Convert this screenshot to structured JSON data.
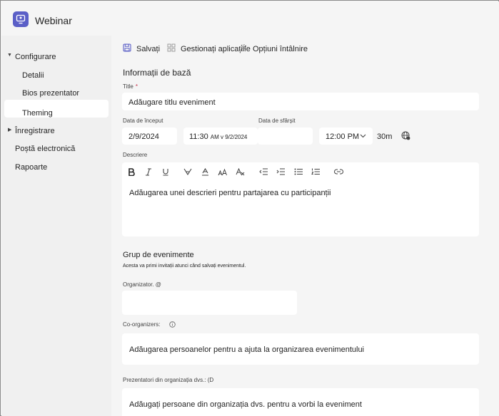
{
  "app": {
    "title": "Webinar"
  },
  "sidebar": {
    "sections": [
      {
        "label": "Configurare",
        "expanded": true
      },
      {
        "label": "Înregistrare",
        "expanded": false
      }
    ],
    "items": [
      {
        "label": "Detalii",
        "selected": true
      },
      {
        "label": "Bios prezentator"
      },
      {
        "label": "Theming"
      },
      {
        "label": "Poștă electronică"
      },
      {
        "label": "Rapoarte"
      }
    ]
  },
  "toolbar": {
    "save_label": "Salvați",
    "manage_apps_label": "Gestionați aplicațiile",
    "meeting_options_label": "Opțiuni întâlnire"
  },
  "form": {
    "basic_info_title": "Informații de bază",
    "title_label": "Title",
    "title_required_mark": "*",
    "title_placeholder": "Adăugare titlu eveniment",
    "start_date_label": "Data de început",
    "start_date": "2/9/2024",
    "start_time": "11:30",
    "start_time_suffix": "AM v 9/2/2024",
    "end_date_label": "Data de sfârșit",
    "end_date": "",
    "end_time": "12:00 PM",
    "duration": "30m",
    "description_label": "Descriere",
    "description_placeholder": "Adăugarea unei descrieri pentru partajarea cu participanții",
    "group_title": "Grup de evenimente",
    "group_help": "Acesta va primi invitații atunci când salvați evenimentul.",
    "organizer_label": "Organizator. @",
    "organizer_value": "",
    "coorganizers_label": "Co-organizers:",
    "coorganizers_placeholder": "Adăugarea persoanelor pentru a ajuta la organizarea evenimentului",
    "presenters_label": "Prezentatori din  organizația dvs.: (D",
    "presenters_placeholder": "Adăugați persoane din organizația dvs. pentru a vorbi la eveniment"
  },
  "rich_text_toolbar": {
    "buttons": [
      "bold-icon",
      "italic-icon",
      "underline-icon",
      "highlight-icon",
      "font-color-icon",
      "font-size-icon",
      "clear-formatting-icon",
      "decrease-indent-icon",
      "increase-indent-icon",
      "bulleted-list-icon",
      "numbered-list-icon",
      "link-icon"
    ]
  },
  "colors": {
    "accent": "#5b5fc7",
    "required": "#c4314b"
  }
}
